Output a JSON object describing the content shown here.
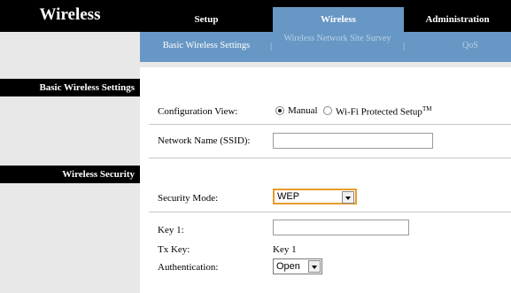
{
  "header": {
    "page_title": "Wireless",
    "tabs": [
      {
        "label": "Setup"
      },
      {
        "label": "Wireless"
      },
      {
        "label": "Administration"
      }
    ]
  },
  "subnav": {
    "items": [
      {
        "label": "Basic Wireless Settings"
      },
      {
        "label": "Wireless Network Site Survey"
      },
      {
        "label": "QoS"
      }
    ],
    "separator": "|"
  },
  "sections": {
    "basic": "Basic Wireless Settings",
    "security": "Wireless Security"
  },
  "form": {
    "config_view_label": "Configuration View:",
    "config_manual_label": "Manual",
    "config_wps_label": "Wi-Fi Protected Setup",
    "config_wps_tm": "TM",
    "ssid_label": "Network Name (SSID):",
    "ssid_value": "",
    "security_mode_label": "Security Mode:",
    "security_mode_value": "WEP",
    "key1_label": "Key 1:",
    "key1_value": "",
    "txkey_label": "Tx Key:",
    "txkey_value": "Key 1",
    "auth_label": "Authentication:",
    "auth_value": "Open"
  },
  "colors": {
    "active_tab": "#6797c4",
    "focus_border": "#e89b2a"
  }
}
